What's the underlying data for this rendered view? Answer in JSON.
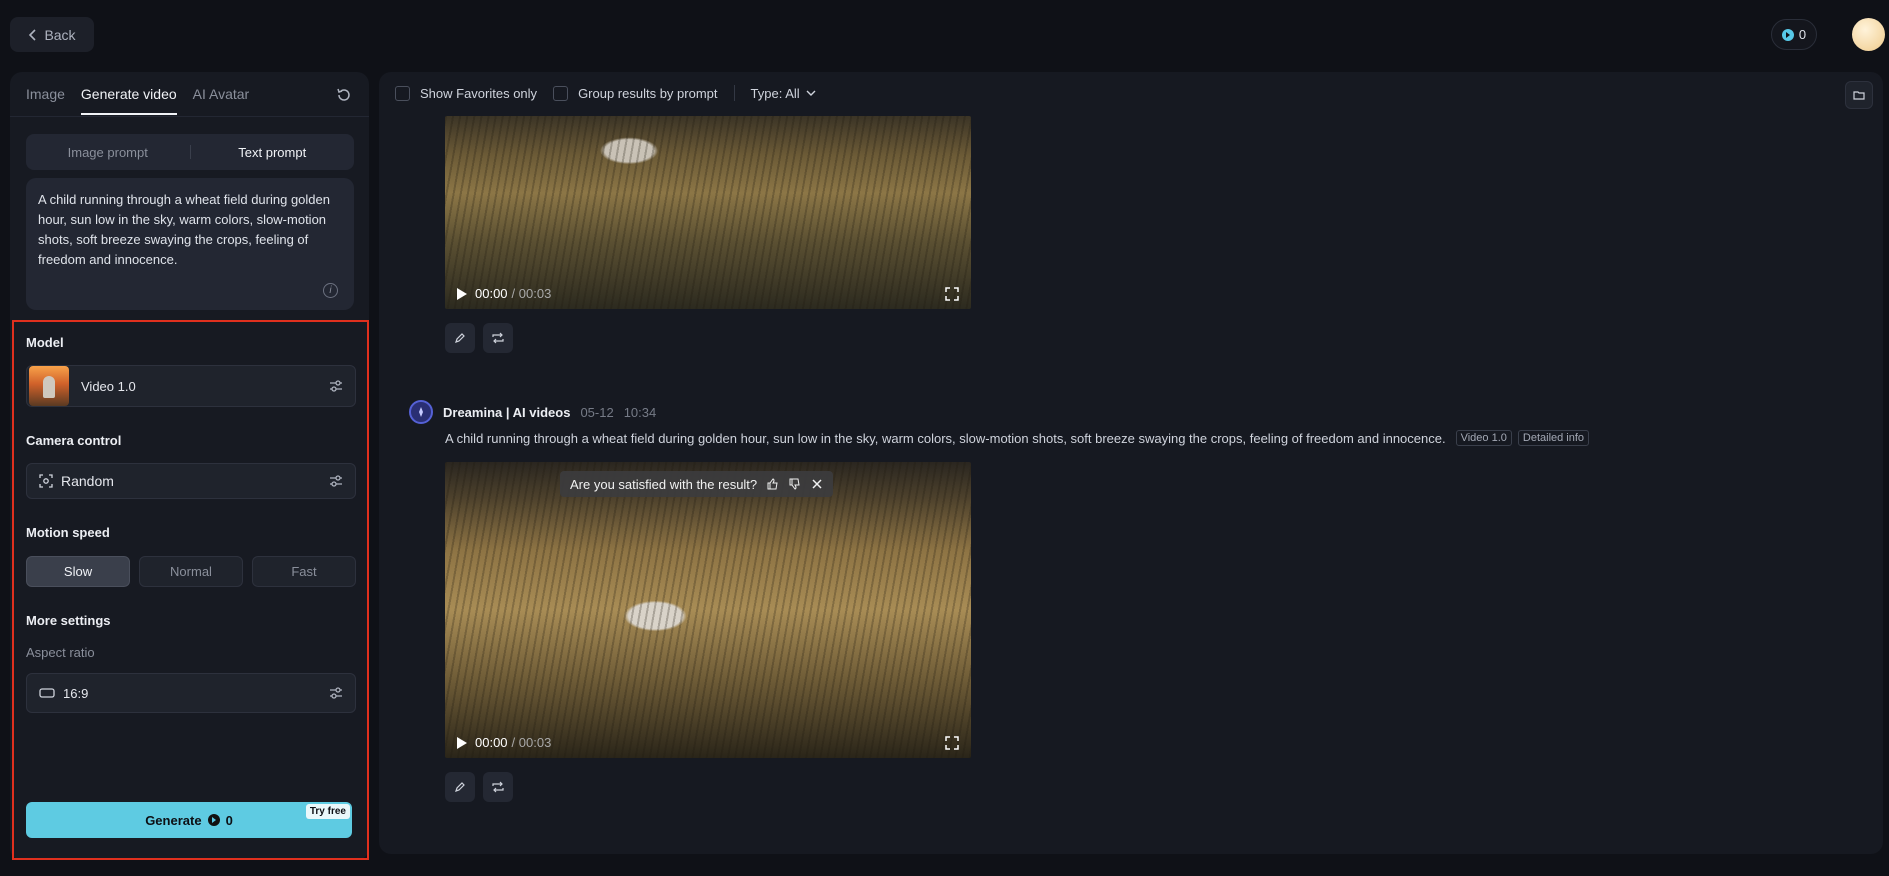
{
  "header": {
    "back_label": "Back",
    "credits": "0"
  },
  "left_panel": {
    "tabs": [
      {
        "label": "Image"
      },
      {
        "label": "Generate video",
        "active": true
      },
      {
        "label": "AI Avatar"
      }
    ],
    "prompt_modes": [
      {
        "label": "Image prompt"
      },
      {
        "label": "Text prompt",
        "active": true
      }
    ],
    "prompt_text": "A child running through a wheat field during golden hour, sun low in the sky, warm colors, slow-motion shots, soft breeze swaying the crops, feeling of freedom and innocence.",
    "model": {
      "label": "Model",
      "value": "Video 1.0"
    },
    "camera": {
      "label": "Camera control",
      "value": "Random"
    },
    "motion": {
      "label": "Motion speed",
      "options": [
        "Slow",
        "Normal",
        "Fast"
      ],
      "selected": "Slow"
    },
    "more": {
      "label": "More settings",
      "aspect_label": "Aspect ratio",
      "aspect_value": "16:9"
    },
    "generate": {
      "label": "Generate",
      "cost": "0",
      "badge": "Try free"
    }
  },
  "main": {
    "filters": {
      "favorites": "Show Favorites only",
      "group": "Group results by prompt",
      "type": "Type: All"
    },
    "results": [
      {
        "time": "00:00",
        "duration": "/ 00:03"
      },
      {
        "author": "Dreamina | AI videos",
        "date": "05-12",
        "clock": "10:34",
        "prompt": "A child running through a wheat field during golden hour, sun low in the sky, warm colors, slow-motion shots, soft breeze swaying the crops, feeling of freedom and innocence.",
        "model_tag": "Video 1.0",
        "info_tag": "Detailed info",
        "feedback": "Are you satisfied with the result?",
        "time": "00:00",
        "duration": "/ 00:03"
      }
    ]
  },
  "colors": {
    "accent": "#5ecbe2",
    "highlight_border": "#e0301e",
    "background": "#0f1117"
  }
}
